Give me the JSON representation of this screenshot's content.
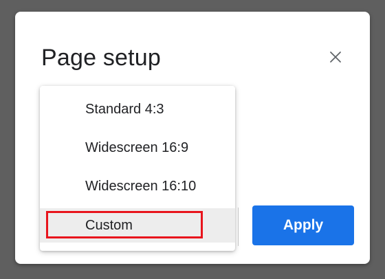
{
  "dialog": {
    "title": "Page setup",
    "close_icon": "close-icon"
  },
  "menu": {
    "items": [
      {
        "label": "Standard 4:3"
      },
      {
        "label": "Widescreen 16:9"
      },
      {
        "label": "Widescreen 16:10"
      },
      {
        "label": "Custom",
        "selected": true
      }
    ]
  },
  "actions": {
    "apply_label": "Apply"
  },
  "colors": {
    "accent": "#1a73e8",
    "highlight": "#e8141c"
  }
}
